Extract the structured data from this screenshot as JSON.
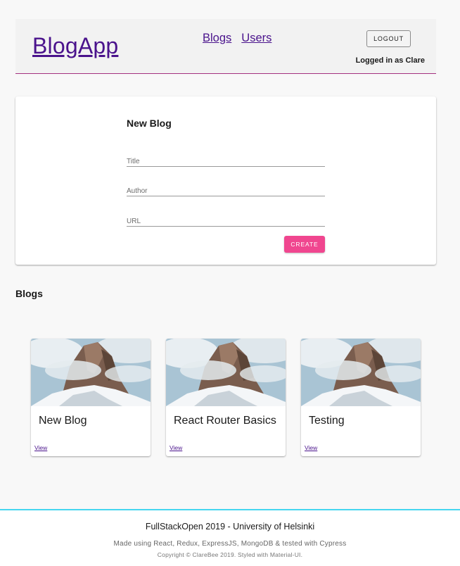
{
  "header": {
    "brand": "BlogApp",
    "nav": [
      "Blogs",
      "Users"
    ],
    "logout_label": "LOGOUT",
    "logged_in_text": "Logged in as Clare",
    "accent_color": "#a3317f"
  },
  "form": {
    "title": "New Blog",
    "title_placeholder": "Title",
    "author_placeholder": "Author",
    "url_placeholder": "URL",
    "create_label": "CREATE",
    "button_color": "#f0468f"
  },
  "blogs": {
    "heading": "Blogs",
    "cards": [
      {
        "title": "New Blog",
        "link": "View"
      },
      {
        "title": "React Router Basics",
        "link": "View"
      },
      {
        "title": "Testing",
        "link": "View"
      }
    ]
  },
  "footer": {
    "main": "FullStackOpen 2019 - University of Helsinki",
    "sub": "Made using React, Redux, ExpressJS, MongoDB & tested with Cypress",
    "copyright": "Copyright © ClareBee 2019. Styled with Material-UI.",
    "border_color": "#45d6f0"
  }
}
